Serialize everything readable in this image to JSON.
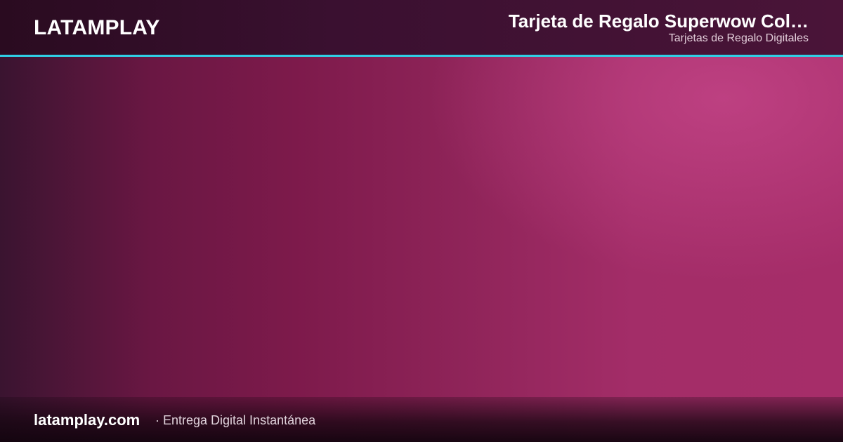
{
  "header": {
    "brand": "LATAMPLAY",
    "product_title": "Tarjeta de Regalo Superwow Col…",
    "category": "Tarjetas de Regalo Digitales"
  },
  "footer": {
    "domain": "latamplay.com",
    "tagline": "· Entrega Digital Instantánea"
  },
  "colors": {
    "accent": "#2fd0e6",
    "background_start": "#3a1430",
    "background_end": "#a62d69",
    "header_bg": "#3a1030"
  }
}
